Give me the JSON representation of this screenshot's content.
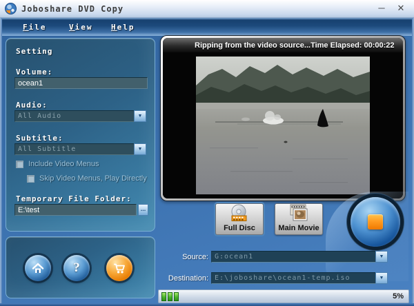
{
  "window": {
    "title": "Joboshare DVD Copy",
    "minimize_glyph": "─",
    "close_glyph": "✕"
  },
  "menu": {
    "items": [
      {
        "initial": "F",
        "rest": "ile"
      },
      {
        "initial": "V",
        "rest": "iew"
      },
      {
        "initial": "H",
        "rest": "elp"
      }
    ]
  },
  "settings": {
    "heading": "Setting",
    "volume": {
      "label": "Volume:",
      "value": "ocean1"
    },
    "audio": {
      "label": "Audio:",
      "value": "All Audio"
    },
    "subtitle": {
      "label": "Subtitle:",
      "value": "All Subtitle"
    },
    "include_video_menus": "Include Video Menus",
    "skip_video_menus": "Skip Video Menus, Play Directly",
    "temp_folder": {
      "label": "Temporary File Folder:",
      "value": "E:\\test"
    },
    "browse_glyph": "..."
  },
  "preview": {
    "status_text": "Ripping from the video source...",
    "time_elapsed": "Time Elapsed: 00:00:22"
  },
  "modes": {
    "full_disc": "Full Disc",
    "main_movie": "Main Movie"
  },
  "output": {
    "source": {
      "label": "Source:",
      "value": "G:ocean1"
    },
    "destination": {
      "label": "Destination:",
      "value": "E:\\joboshare\\ocean1-temp.iso"
    }
  },
  "status_bar": {
    "progress_blocks": 3,
    "percent": "5%"
  },
  "footer_buttons": {
    "help_glyph": "?"
  },
  "icons": {
    "dropdown_arrow": "▼"
  },
  "colors": {
    "selection_blue": "#4e85bb",
    "progress_green": "#3fae2a",
    "buy_orange": "#ee8500",
    "stop_orange": "#ff9a1f"
  }
}
